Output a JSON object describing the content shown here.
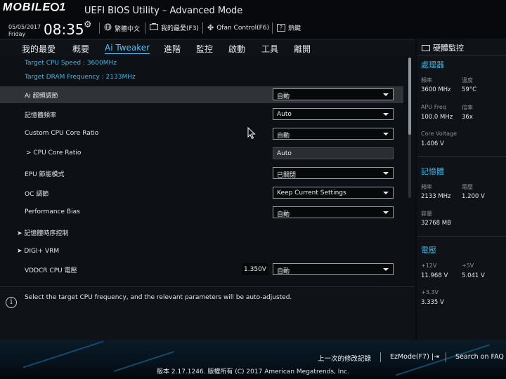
{
  "header": {
    "brand": "MOBILE01",
    "title": "UEFI BIOS Utility – Advanced Mode",
    "date": "05/05/2017",
    "weekday": "Friday",
    "time": "08:35",
    "buttons": [
      {
        "icon": "globe-icon",
        "label": "繁體中文"
      },
      {
        "icon": "favorites-icon",
        "label": "我的最愛(F3)"
      },
      {
        "icon": "fan-icon",
        "label": "Qfan Control(F6)"
      },
      {
        "icon": "help-icon",
        "label": "熱鍵"
      }
    ]
  },
  "tabs": [
    {
      "label": "我的最愛",
      "active": false
    },
    {
      "label": "概要",
      "active": false
    },
    {
      "label": "Ai Tweaker",
      "active": true
    },
    {
      "label": "進階",
      "active": false
    },
    {
      "label": "監控",
      "active": false
    },
    {
      "label": "啟動",
      "active": false
    },
    {
      "label": "工具",
      "active": false
    },
    {
      "label": "離開",
      "active": false
    }
  ],
  "main": {
    "info": [
      "Target CPU Speed : 3600MHz",
      "Target DRAM Frequency : 2133MHz"
    ],
    "settings": [
      {
        "label": "Ai 超頻調節",
        "value": "自動"
      },
      {
        "label": "記憶體頻率",
        "value": "Auto"
      },
      {
        "label": "Custom CPU Core Ratio",
        "value": "自動"
      },
      {
        "label": "> CPU Core Ratio",
        "value": "Auto"
      },
      {
        "label": "EPU 節能模式",
        "value": "已關閉"
      },
      {
        "label": "OC 調節",
        "value": "Keep Current Settings"
      },
      {
        "label": "Performance Bias",
        "value": "自動"
      },
      {
        "label": "記憶體時序控制"
      },
      {
        "label": "DIGI+ VRM"
      },
      {
        "label": "VDDCR CPU 電壓",
        "voltage": "1.350V",
        "value": "自動"
      }
    ],
    "help_text": "Select the target CPU frequency, and the relevant parameters will be auto-adjusted."
  },
  "hardware_monitor": {
    "title": "硬體監控",
    "cpu": {
      "heading": "處理器",
      "freq_label": "頻率",
      "freq_value": "3600 MHz",
      "temp_label": "溫度",
      "temp_value": "59°C",
      "apu_label": "APU Freq",
      "apu_value": "100.0 MHz",
      "ratio_label": "倍率",
      "ratio_value": "36x",
      "voltage_label": "Core Voltage",
      "voltage_value": "1.406 V"
    },
    "memory": {
      "heading": "記憶體",
      "freq_label": "頻率",
      "freq_value": "2133 MHz",
      "volt_label": "電壓",
      "volt_value": "1.200 V",
      "cap_label": "容量",
      "cap_value": "32768 MB"
    },
    "voltage": {
      "heading": "電壓",
      "v12_label": "+12V",
      "v12_value": "11.968 V",
      "v5_label": "+5V",
      "v5_value": "5.041 V",
      "v33_label": "+3.3V",
      "v33_value": "3.335 V"
    }
  },
  "footer": {
    "last_modified": "上一次的修改記錄",
    "ezmode": "EzMode(F7)",
    "search": "Search on FAQ",
    "copyright": "版本 2.17.1246. 版權所有 (C) 2017 American Megatrends, Inc."
  },
  "colors": {
    "accent": "#3fb6e8",
    "panel": "#0d1014",
    "selected_row": "#2f3338"
  }
}
